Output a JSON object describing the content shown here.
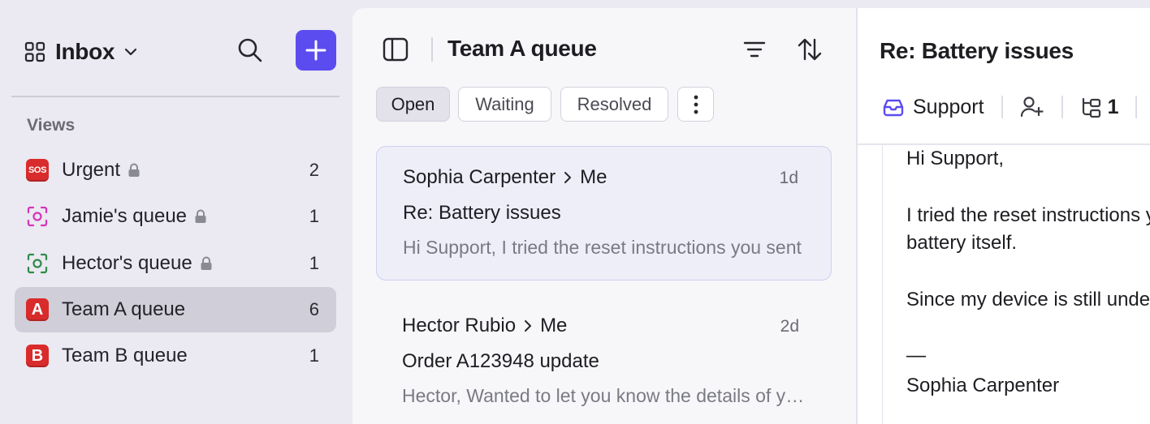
{
  "sidebar": {
    "inbox_title": "Inbox",
    "views_heading": "Views",
    "views": [
      {
        "label": "Urgent",
        "count": "2",
        "icon": "sos-icon",
        "badge": "SOS",
        "locked": true
      },
      {
        "label": "Jamie's queue",
        "count": "1",
        "icon": "focus-icon-magenta",
        "locked": true
      },
      {
        "label": "Hector's queue",
        "count": "1",
        "icon": "focus-icon-green",
        "locked": true
      },
      {
        "label": "Team A queue",
        "count": "6",
        "icon": "letter-a-icon",
        "badge": "A",
        "locked": false,
        "active": true
      },
      {
        "label": "Team B queue",
        "count": "1",
        "icon": "letter-b-icon",
        "badge": "B",
        "locked": false
      }
    ]
  },
  "list": {
    "title": "Team A queue",
    "tabs": [
      {
        "label": "Open",
        "active": true
      },
      {
        "label": "Waiting",
        "active": false
      },
      {
        "label": "Resolved",
        "active": false
      }
    ],
    "conversations": [
      {
        "from": "Sophia Carpenter",
        "to": "Me",
        "time": "1d",
        "subject": "Re: Battery issues",
        "preview": "Hi Support, I tried the reset instructions you sent",
        "selected": true
      },
      {
        "from": "Hector Rubio",
        "to": "Me",
        "time": "2d",
        "subject": "Order A123948 update",
        "preview": "Hector, Wanted to let you know the details of your order",
        "selected": false
      }
    ]
  },
  "detail": {
    "title": "Re: Battery issues",
    "inbox_label": "Support",
    "thread_count": "1",
    "body_lines": [
      "Hi Support,",
      "I tried the reset instructions you sent",
      "battery itself.",
      "Since my device is still under warranty",
      "—",
      "Sophia Carpenter"
    ]
  },
  "colors": {
    "accent": "#5b4cf0",
    "sidebar_bg": "#ebe9f1",
    "active_view_bg": "#d0ced9",
    "selected_conv_bg": "#eeeef9",
    "badge_red": "#d92b2b"
  }
}
